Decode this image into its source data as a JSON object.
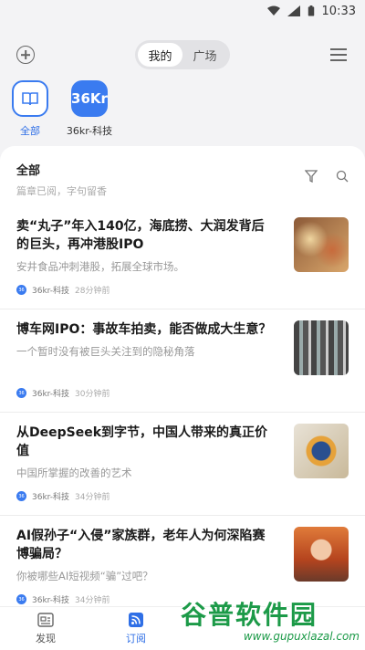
{
  "status": {
    "time": "10:33"
  },
  "top": {
    "tabs": [
      "我的",
      "广场"
    ],
    "active_tab": 0
  },
  "sources": [
    {
      "label": "全部",
      "icon": "book-icon"
    },
    {
      "label": "36kr-科技",
      "logo_text": "36Kr"
    }
  ],
  "section": {
    "title": "全部",
    "subtitle": "篇章已阅，字句留香"
  },
  "articles": [
    {
      "title": "卖“丸子”年入140亿，海底捞、大润发背后的巨头，再冲港股IPO",
      "desc": "安井食品冲刺港股，拓展全球市场。",
      "source": "36kr-科技",
      "time": "28分钟前"
    },
    {
      "title": "博车网IPO：事故车拍卖，能否做成大生意？",
      "desc": "一个暂时没有被巨头关注到的隐秘角落",
      "source": "36kr-科技",
      "time": "30分钟前"
    },
    {
      "title": "从DeepSeek到字节，中国人带来的真正价值",
      "desc": "中国所掌握的改善的艺术",
      "source": "36kr-科技",
      "time": "34分钟前"
    },
    {
      "title": "AI假孙子“入侵”家族群，老年人为何深陷赛博骗局？",
      "desc": "你被哪些AI短视频“骗”过吧？",
      "source": "36kr-科技",
      "time": "34分钟前"
    }
  ],
  "nav": {
    "find": "发现",
    "subscribe": "订阅"
  },
  "watermark": {
    "title": "谷普软件园",
    "url": "www.gupuxlazal.com"
  },
  "colors": {
    "accent": "#3a7bf0",
    "watermark": "#1c9a48"
  }
}
